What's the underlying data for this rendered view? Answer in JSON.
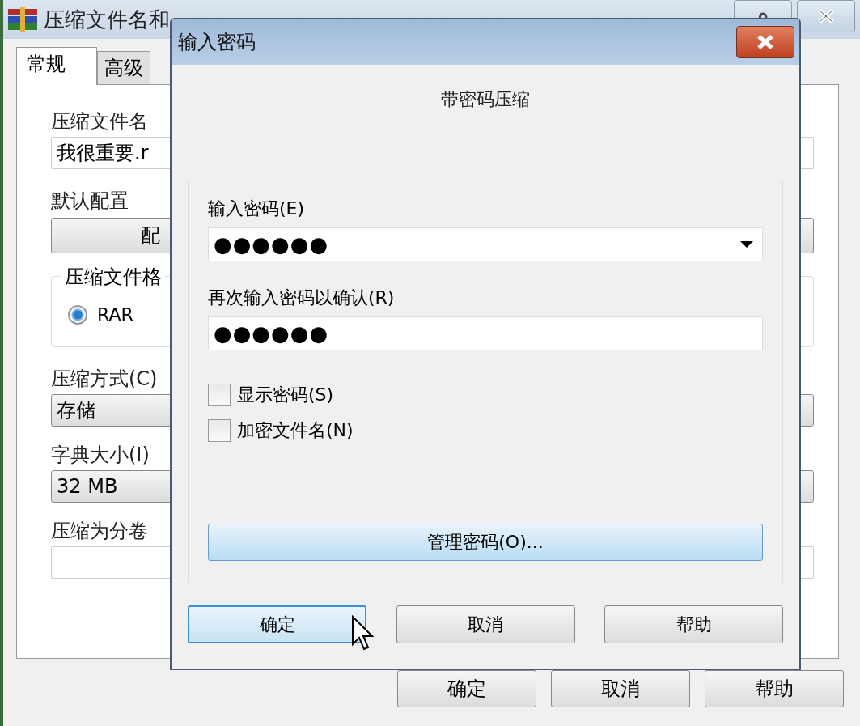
{
  "main_window": {
    "title": "压缩文件名和",
    "tabs": [
      {
        "label": "常规",
        "selected": true
      },
      {
        "label": "高级",
        "selected": false
      }
    ],
    "archive_name": {
      "label": "压缩文件名",
      "value": "我很重要.r"
    },
    "profiles": {
      "label": "默认配置",
      "button": "配"
    },
    "archive_format": {
      "label": "压缩文件格",
      "options": [
        {
          "label": "RAR",
          "selected": true
        }
      ]
    },
    "compression_method": {
      "label": "压缩方式(C)",
      "value": "存储"
    },
    "dictionary_size": {
      "label": "字典大小(I)",
      "value": "32 MB"
    },
    "split_volumes": {
      "label": "压缩为分卷"
    },
    "buttons": [
      "确定",
      "取消",
      "帮助"
    ]
  },
  "dialog": {
    "title": "输入密码",
    "heading": "带密码压缩",
    "password": {
      "label": "输入密码(E)",
      "value": "●●●●●●"
    },
    "confirm": {
      "label": "再次输入密码以确认(R)",
      "value": "●●●●●●"
    },
    "options": [
      {
        "label": "显示密码(S)",
        "checked": false
      },
      {
        "label": "加密文件名(N)",
        "checked": false
      }
    ],
    "organize_button": "管理密码(O)...",
    "buttons": [
      {
        "label": "确定",
        "focused": true
      },
      {
        "label": "取消",
        "focused": false
      },
      {
        "label": "帮助",
        "focused": false
      }
    ]
  }
}
